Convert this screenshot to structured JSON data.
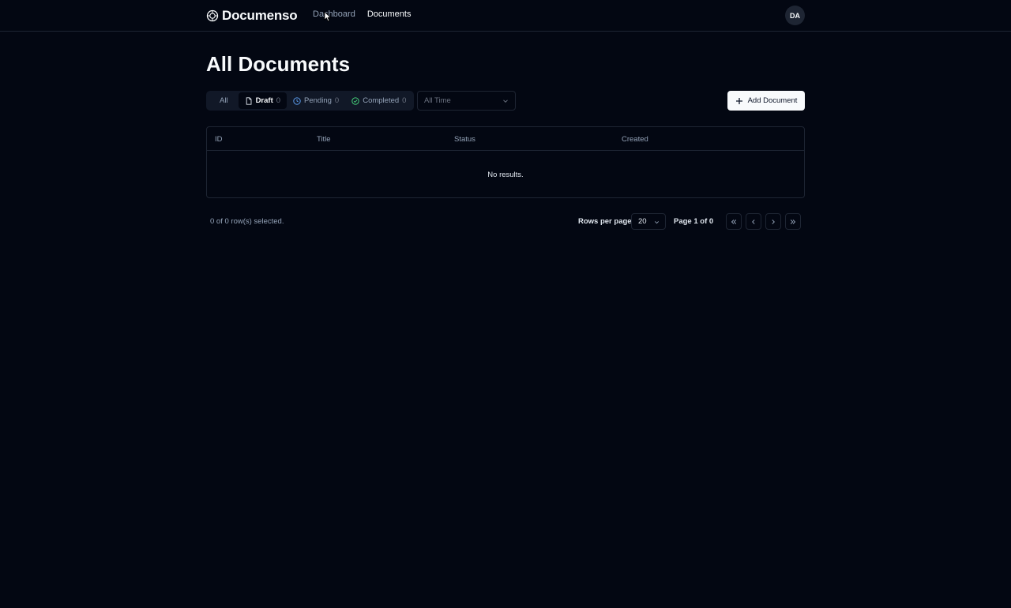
{
  "app": {
    "name": "Documenso"
  },
  "nav": {
    "dashboard": "Dashboard",
    "documents": "Documents"
  },
  "user": {
    "initials": "DA"
  },
  "page": {
    "title": "All Documents"
  },
  "status_tabs": {
    "all": "All",
    "draft_label": "Draft",
    "draft_count": "0",
    "pending_label": "Pending",
    "pending_count": "0",
    "completed_label": "Completed",
    "completed_count": "0",
    "selected": "Draft"
  },
  "period_filter": {
    "value": "All Time"
  },
  "actions": {
    "add_document": "Add Document"
  },
  "table": {
    "columns": [
      "ID",
      "Title",
      "Status",
      "Created"
    ],
    "empty_message": "No results."
  },
  "pagination": {
    "selection": "0 of 0 row(s) selected.",
    "rows_per_page_label": "Rows per page",
    "rows_per_page": "20",
    "page_info": "Page 1 of 0"
  },
  "colors": {
    "background": "#030712",
    "pending_icon": "#60a5fa",
    "completed_icon": "#4ade80"
  },
  "icons": {
    "logo": "documenso-logo-icon",
    "draft": "file-icon",
    "pending": "clock-icon",
    "completed": "check-circle-icon",
    "add": "plus-icon"
  }
}
